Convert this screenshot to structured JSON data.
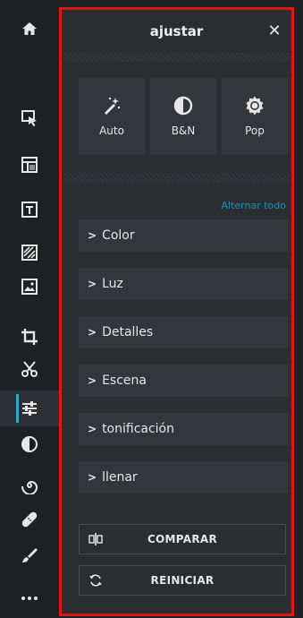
{
  "panel": {
    "title": "ajustar",
    "close_glyph": "✕",
    "presets": [
      {
        "label": "Auto",
        "icon": "magic-wand-icon"
      },
      {
        "label": "B&N",
        "icon": "contrast-icon"
      },
      {
        "label": "Pop",
        "icon": "sun-burst-icon"
      }
    ],
    "toggle_all_label": "Alternar todo",
    "sections": [
      {
        "label": "Color"
      },
      {
        "label": "Luz"
      },
      {
        "label": "Detalles"
      },
      {
        "label": "Escena"
      },
      {
        "label": "tonificación"
      },
      {
        "label": "llenar"
      }
    ],
    "compare_label": "COMPARAR",
    "reset_label": "REINICIAR"
  },
  "rail": {
    "items": [
      {
        "name": "home-icon"
      },
      {
        "name": "select-cursor-icon"
      },
      {
        "name": "layout-icon"
      },
      {
        "name": "text-icon"
      },
      {
        "name": "texture-icon"
      },
      {
        "name": "image-icon"
      },
      {
        "name": "crop-icon"
      },
      {
        "name": "cut-icon"
      },
      {
        "name": "adjust-sliders-icon",
        "active": true
      },
      {
        "name": "contrast-icon"
      },
      {
        "name": "spiral-icon"
      },
      {
        "name": "bandage-icon"
      },
      {
        "name": "brush-icon"
      },
      {
        "name": "more-icon"
      }
    ]
  },
  "colors": {
    "background": "#1f2023",
    "panel": "#2b2e31",
    "accent": "#2aa9d6",
    "highlight_border": "#e01515",
    "link": "#1b8fbf"
  }
}
